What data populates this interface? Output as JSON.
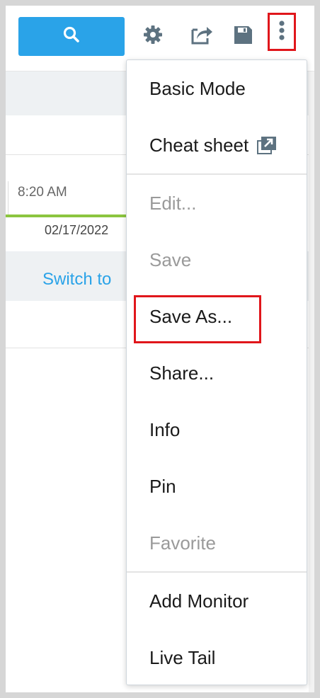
{
  "toolbar": {
    "search_icon": "search-icon",
    "settings_icon": "gear-icon",
    "share_icon": "share-export-icon",
    "save_icon": "floppy-disk-icon",
    "more_icon": "vertical-ellipsis-icon"
  },
  "background": {
    "time": "8:20 AM",
    "date": "02/17/2022",
    "switch_link": "Switch to"
  },
  "menu": {
    "items": [
      {
        "label": "Basic Mode",
        "enabled": true
      },
      {
        "label": "Cheat sheet",
        "enabled": true,
        "icon": "external-link-icon"
      },
      {
        "label": "Edit...",
        "enabled": false
      },
      {
        "label": "Save",
        "enabled": false
      },
      {
        "label": "Save As...",
        "enabled": true,
        "highlighted": true
      },
      {
        "label": "Share...",
        "enabled": true
      },
      {
        "label": "Info",
        "enabled": true
      },
      {
        "label": "Pin",
        "enabled": true
      },
      {
        "label": "Favorite",
        "enabled": false
      },
      {
        "label": "Add Monitor",
        "enabled": true
      },
      {
        "label": "Live Tail",
        "enabled": true
      }
    ]
  },
  "colors": {
    "accent": "#2aa3e8",
    "highlight": "#e0161b",
    "icon_gray": "#5d7280",
    "disabled_text": "#9a9a9a",
    "green_bar": "#8bc53f"
  }
}
